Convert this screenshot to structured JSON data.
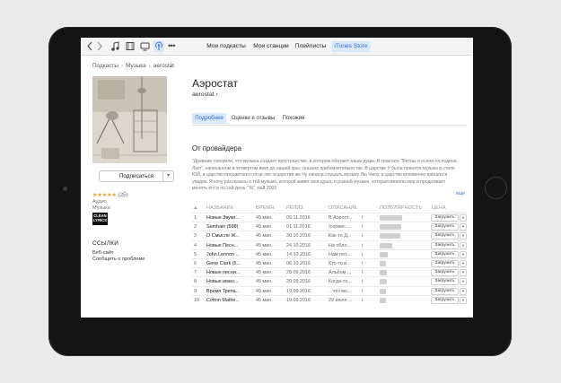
{
  "toolbar": {
    "icons": [
      "back-icon",
      "forward-icon",
      "music-icon",
      "movies-icon",
      "tv-icon",
      "podcasts-icon",
      "more-icon"
    ],
    "tabs": [
      {
        "label": "Мои подкасты",
        "active": false
      },
      {
        "label": "Мои станции",
        "active": false
      },
      {
        "label": "Плейлисты",
        "active": false
      },
      {
        "label": "iTunes Store",
        "active": true
      }
    ]
  },
  "breadcrumb": [
    "Подкасты",
    "Музыка",
    "aerostat"
  ],
  "podcast": {
    "title": "Аэростат",
    "author": "aerostat",
    "subscribe_label": "Подписаться",
    "rating_stars": "★★★★★",
    "rating_count": "(25)",
    "meta_lines": [
      "Аудио",
      "Музыка"
    ],
    "explicit_badge": [
      "CLEAN",
      "LYRICS"
    ]
  },
  "links": {
    "title": "ССЫЛКИ",
    "items": [
      "Веб-сайт",
      "Сообщить о проблеме"
    ]
  },
  "content_tabs": [
    {
      "label": "Подробнее",
      "active": true
    },
    {
      "label": "Оценки и отзывы",
      "active": false
    },
    {
      "label": "Похожие",
      "active": false
    }
  ],
  "provider": {
    "title": "От провайдера",
    "description": "\"Древние говорили, что музыка создает пространство, в котором обитают наши души. В трактате \"Весны и осени господина Люя\", написанном в четвертом веке до нашей эры, сказано приблизительно так: В царстве У была принята музыка в стиле ЮЙ, и царство процветало сотни лет, в царстве же Чу начали слушать музыку Лю Чжоу, и царство мгновенно пришло в упадок. Я хочу рассказать о той музыке, которой живет моя душа, о разной музыке, которая меняла мир и продолжает менять его и по сей день.\" БГ, май 2005",
    "more_label": "еще"
  },
  "table": {
    "sort_indicator": "▲",
    "headers": [
      "НАЗВАНИЕ",
      "ВРЕМЯ",
      "РЕЛИЗ",
      "ОПИСАНИЕ",
      "ПОПУЛЯРНОСТЬ",
      "ЦЕНА"
    ],
    "download_label": "Загрузить",
    "rows": [
      {
        "num": "1",
        "name": "Новые Звуки...",
        "time": "45 мин.",
        "release": "09.11.2016",
        "desc": "В Аэрост...",
        "popularity": 0.95
      },
      {
        "num": "2",
        "name": "Samhain (598)",
        "time": "45 мин.",
        "release": "01.11.2016",
        "desc": "/сервис ...",
        "popularity": 0.92
      },
      {
        "num": "3",
        "name": "О Смысле Ж...",
        "time": "45 мин.",
        "release": "30.10.2016",
        "desc": "Как-то Д...",
        "popularity": 0.88
      },
      {
        "num": "4",
        "name": "Новые Песн...",
        "time": "45 мин.",
        "release": "24.10.2016",
        "desc": "На обло...",
        "popularity": 0.55
      },
      {
        "num": "5",
        "name": "John Lennon ...",
        "time": "45 мин.",
        "release": "14.10.2016",
        "desc": "Нам пот...",
        "popularity": 0.35
      },
      {
        "num": "6",
        "name": "Gene Clark (5...",
        "time": "45 мин.",
        "release": "06.10.2016",
        "desc": "Кто-то и...",
        "popularity": 0.25
      },
      {
        "num": "7",
        "name": "Новые песни...",
        "time": "45 мин.",
        "release": "28.09.2016",
        "desc": "Альбом ...",
        "popularity": 0.32
      },
      {
        "num": "8",
        "name": "Новые имен...",
        "time": "45 мин.",
        "release": "20.09.2016",
        "desc": "Когда-то...",
        "popularity": 0.3
      },
      {
        "num": "9",
        "name": "Время Трепа...",
        "time": "45 мин.",
        "release": "19.09.2016",
        "desc": "...что мо...",
        "popularity": 0.28
      },
      {
        "num": "10",
        "name": "Cotton Mathe...",
        "time": "45 мин.",
        "release": "19.09.2016",
        "desc": "29 июля ...",
        "popularity": 0.26
      }
    ]
  }
}
